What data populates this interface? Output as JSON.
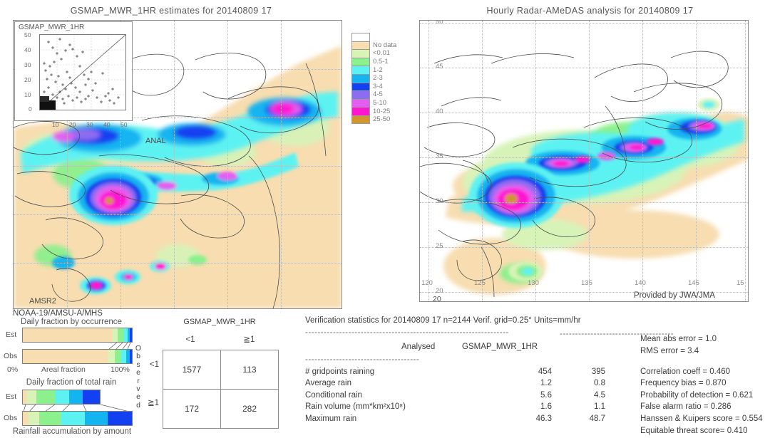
{
  "left_panel": {
    "title": "GSMAP_MWR_1HR estimates for 20140809 17",
    "inset_title": "GSMAP_MWR_1HR",
    "inset_y_ticks": [
      "50",
      "40",
      "30",
      "20",
      "10",
      "0"
    ],
    "inset_x_ticks": [
      "10",
      "20",
      "30",
      "40",
      "50"
    ],
    "overlay_label_anal": "ANAL",
    "overlay_label_sensor": "AMSR2",
    "footer_label": "NOAA-19/AMSU-A/MHS"
  },
  "right_panel": {
    "title": "Hourly Radar-AMeDAS analysis for 20140809 17",
    "credit": "Provided by JWA/JMA",
    "lat_ticks": [
      "50",
      "45",
      "40",
      "35",
      "30",
      "25",
      "20"
    ],
    "lon_ticks": [
      "120",
      "125",
      "130",
      "135",
      "140",
      "145",
      "15"
    ],
    "corner_lon": "20"
  },
  "legend": {
    "entries": [
      {
        "label": "No data",
        "color": "#f7ddb0"
      },
      {
        "label": "<0.01",
        "color": "#d8f3b8"
      },
      {
        "label": "0.5-1",
        "color": "#8cf08c"
      },
      {
        "label": "1-2",
        "color": "#5df2f2"
      },
      {
        "label": "2-3",
        "color": "#14b4f0"
      },
      {
        "label": "3-4",
        "color": "#1340f0"
      },
      {
        "label": "4-5",
        "color": "#8c6df0"
      },
      {
        "label": "5-10",
        "color": "#e35ef0"
      },
      {
        "label": "10-25",
        "color": "#ff14d2"
      },
      {
        "label": "25-50",
        "color": "#d2962d"
      }
    ],
    "top_blank_color": "#ffffff"
  },
  "occurrence_panel": {
    "title": "Daily fraction by occurrence",
    "row_labels": [
      "Est",
      "Obs"
    ],
    "axis_left": "0%",
    "axis_center": "Areal fraction",
    "axis_right": "100%",
    "est_segments": [
      {
        "color": "#f7ddb0",
        "pct": 82.0
      },
      {
        "color": "#d8f3b8",
        "pct": 5.0
      },
      {
        "color": "#8cf08c",
        "pct": 6.0
      },
      {
        "color": "#5df2f2",
        "pct": 3.0
      },
      {
        "color": "#14b4f0",
        "pct": 2.0
      },
      {
        "color": "#1340f0",
        "pct": 2.0
      }
    ],
    "obs_segments": [
      {
        "color": "#f7ddb0",
        "pct": 78.0
      },
      {
        "color": "#d8f3b8",
        "pct": 6.0
      },
      {
        "color": "#8cf08c",
        "pct": 6.0
      },
      {
        "color": "#5df2f2",
        "pct": 5.0
      },
      {
        "color": "#14b4f0",
        "pct": 3.0
      },
      {
        "color": "#1340f0",
        "pct": 2.0
      }
    ]
  },
  "total_rain_panel": {
    "title": "Daily fraction of total rain",
    "row_labels": [
      "Est",
      "Obs"
    ],
    "footer": "Rainfall accumulation by amount",
    "est_segments": [
      {
        "color": "#f7ddb0",
        "pct": 4.0
      },
      {
        "color": "#d8f3b8",
        "pct": 10.0
      },
      {
        "color": "#8cf08c",
        "pct": 18.0
      },
      {
        "color": "#5df2f2",
        "pct": 14.0
      },
      {
        "color": "#14b4f0",
        "pct": 14.0
      },
      {
        "color": "#1340f0",
        "pct": 14.0
      }
    ],
    "obs_segments": [
      {
        "color": "#f7ddb0",
        "pct": 5.0
      },
      {
        "color": "#d8f3b8",
        "pct": 10.0
      },
      {
        "color": "#8cf08c",
        "pct": 20.0
      },
      {
        "color": "#5df2f2",
        "pct": 22.0
      },
      {
        "color": "#14b4f0",
        "pct": 21.0
      },
      {
        "color": "#1340f0",
        "pct": 22.0
      }
    ]
  },
  "contingency": {
    "title": "GSMAP_MWR_1HR",
    "col_headers": [
      "<1",
      "≧1"
    ],
    "row_headers": [
      "<1",
      "≧1"
    ],
    "side_label": "Observed",
    "cells": [
      [
        "1577",
        "113"
      ],
      [
        "172",
        "282"
      ]
    ]
  },
  "stats": {
    "header": "Verification statistics for 20140809 17   n=2144   Verif. grid=0.25°  Units=mm/hr",
    "rule": "------------------------------------------------------------------",
    "col_header_analysed": "Analysed",
    "col_header_model": "GSMAP_MWR_1HR",
    "rule2": "-------------------------------------",
    "rows": [
      {
        "label": "# gridpoints raining",
        "analysed": "454",
        "model": "395"
      },
      {
        "label": "Average rain",
        "analysed": "1.2",
        "model": "0.8"
      },
      {
        "label": "Conditional rain",
        "analysed": "5.6",
        "model": "4.5"
      },
      {
        "label": "Rain volume (mm*km²x10⁸)",
        "analysed": "1.6",
        "model": "1.1"
      },
      {
        "label": "Maximum rain",
        "analysed": "46.3",
        "model": "48.7"
      }
    ],
    "scores": [
      "Mean abs error  =  1.0",
      "RMS error  =  3.4",
      "Correlation coeff  =  0.460",
      "Frequency bias  =  0.870",
      "Probability of detection  =  0.621",
      "False alarm ratio  =  0.286",
      "Hanssen & Kuipers score  =  0.554",
      "Equitable threat score=  0.410"
    ]
  }
}
